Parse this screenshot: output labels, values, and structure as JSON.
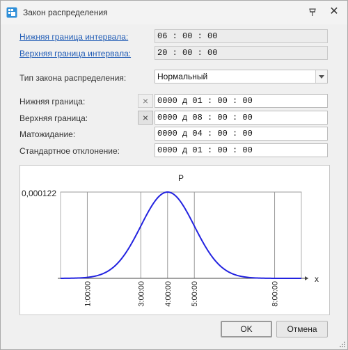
{
  "window": {
    "title": "Закон распределения"
  },
  "icons": {
    "app": "distribution-icon",
    "pin": "pin-icon",
    "close": "close-icon",
    "clear": "clear-x-icon",
    "dropdown": "chevron-down-icon"
  },
  "form": {
    "lower_interval": {
      "label": "Нижняя граница интервала:",
      "value": "06 : 00 : 00"
    },
    "upper_interval": {
      "label": "Верхняя граница интервала:",
      "value": "20 : 00 : 00"
    },
    "law_type": {
      "label": "Тип закона распределения:",
      "value": "Нормальный"
    },
    "lower_bound": {
      "label": "Нижняя граница:",
      "value": "0000 д  01 : 00 : 00"
    },
    "upper_bound": {
      "label": "Верхняя граница:",
      "value": "0000 д  08 : 00 : 00"
    },
    "mean": {
      "label": "Матожидание:",
      "value": "0000 д  04 : 00 : 00"
    },
    "std": {
      "label": "Стандартное отклонение:",
      "value": "0000 д  01 : 00 : 00"
    },
    "clear_glyph": "×"
  },
  "buttons": {
    "ok": "OK",
    "cancel": "Отмена"
  },
  "colors": {
    "curve": "#2323e0",
    "link": "#1f5bb5"
  },
  "chart_data": {
    "type": "line",
    "title": "P",
    "xlabel": "x",
    "ylabel": "",
    "y_max_label": "0,000122",
    "ylim": [
      0,
      0.000122
    ],
    "xlim_hours": [
      0,
      9
    ],
    "x_ticks": [
      {
        "hours": 1,
        "label": "1:00:00"
      },
      {
        "hours": 3,
        "label": "3:00:00"
      },
      {
        "hours": 4,
        "label": "4:00:00"
      },
      {
        "hours": 5,
        "label": "5:00:00"
      },
      {
        "hours": 8,
        "label": "8:00:00"
      }
    ],
    "distribution": {
      "kind": "normal",
      "mean_hours": 4,
      "std_hours": 1,
      "peak_density": 0.000122
    },
    "series": [
      {
        "x_hours": [
          0,
          1,
          1.5,
          2,
          2.5,
          3,
          3.5,
          4,
          4.5,
          5,
          5.5,
          6,
          6.5,
          7,
          7.5,
          8,
          9
        ],
        "y": [
          0,
          1.3e-06,
          5.3e-06,
          1.65e-05,
          3.95e-05,
          7.4e-05,
          0.0001077,
          0.000122,
          0.0001077,
          7.4e-05,
          3.95e-05,
          1.65e-05,
          5.3e-06,
          1.3e-06,
          3e-07,
          0,
          0
        ]
      }
    ]
  }
}
